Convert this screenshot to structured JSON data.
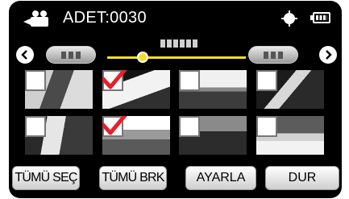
{
  "header": {
    "count_label": "ADET:0030",
    "mode_icon": "video-camera-mode-icon",
    "status_icon": "record-status-dot-icon",
    "battery_icon": "battery-icon"
  },
  "navigation": {
    "prev_icon": "chevron-left-icon",
    "next_icon": "chevron-right-icon",
    "slider_color": "#f3df2a"
  },
  "thumbnails": [
    {
      "checked": false
    },
    {
      "checked": true
    },
    {
      "checked": false
    },
    {
      "checked": false
    },
    {
      "checked": false
    },
    {
      "checked": true
    },
    {
      "checked": false
    },
    {
      "checked": false
    }
  ],
  "colors": {
    "checkmark": "#e8202a",
    "background": "#000000"
  },
  "buttons": {
    "select_all": "TÜMÜ SEÇ",
    "deselect_all": "TÜMÜ BRK",
    "set": "AYARLA",
    "stop": "DUR"
  }
}
